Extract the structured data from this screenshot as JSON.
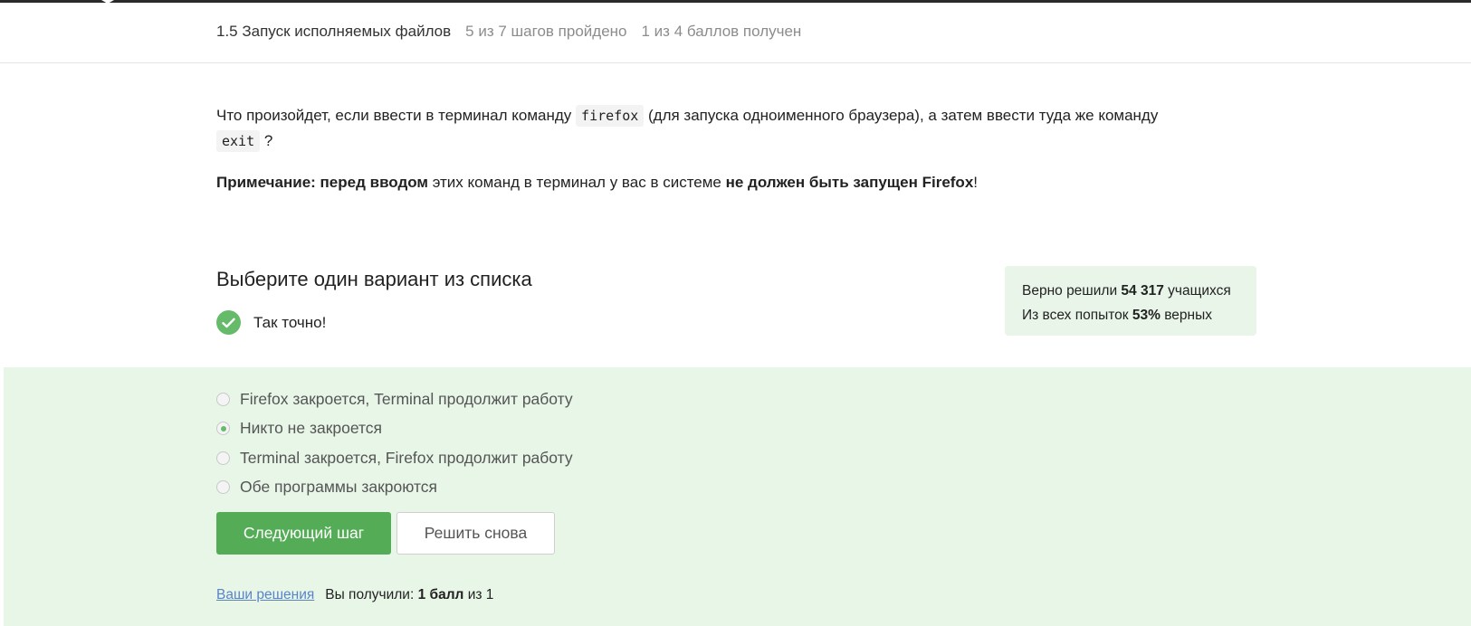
{
  "header": {
    "lesson_title": "1.5 Запуск исполняемых файлов",
    "steps_progress": "5 из 7 шагов пройдено",
    "score_progress": "1 из 4 баллов  получен"
  },
  "question": {
    "text_part1": "Что произойдет, если ввести в терминал команду ",
    "code1": "firefox",
    "text_part2": " (для запуска одноименного браузера), а затем ввести туда же команду ",
    "code2": "exit",
    "text_part3": " ?"
  },
  "note": {
    "bold1": "Примечание: перед вводом",
    "text1": " этих команд в терминал у вас в системе ",
    "bold2": "не должен быть запущен Firefox",
    "text2": "!"
  },
  "quiz": {
    "heading": "Выберите один вариант из списка",
    "feedback": "Так точно!",
    "stats": {
      "line1_prefix": "Верно решили ",
      "line1_value": "54 317",
      "line1_suffix": " учащихся",
      "line2_prefix": "Из всех попыток ",
      "line2_value": "53%",
      "line2_suffix": " верных"
    },
    "options": [
      {
        "label": "Firefox закроется, Terminal продолжит работу",
        "selected": false
      },
      {
        "label": "Никто не закроется",
        "selected": true
      },
      {
        "label": "Terminal закроется, Firefox продолжит работу",
        "selected": false
      },
      {
        "label": "Обе программы закроются",
        "selected": false
      }
    ],
    "next_button": "Следующий шаг",
    "retry_button": "Решить снова"
  },
  "footer": {
    "solutions_link": "Ваши решения",
    "result_prefix": "Вы получили: ",
    "result_value": "1 балл",
    "result_suffix": " из 1"
  },
  "colors": {
    "accent_green": "#54ad56",
    "answer_background": "#e8f6e8",
    "link_blue": "#5a84c8"
  }
}
